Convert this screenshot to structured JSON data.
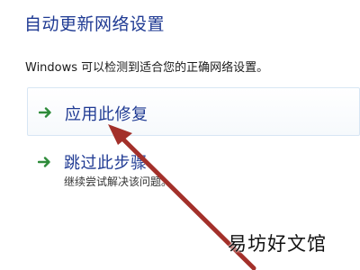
{
  "dialog": {
    "title": "自动更新网络设置",
    "description": "Windows 可以检测到适合您的正确网络设置。"
  },
  "options": {
    "apply": {
      "label": "应用此修复",
      "icon": "green-arrow-icon"
    },
    "skip": {
      "label": "跳过此步骤",
      "sublabel": "继续尝试解决该问题。",
      "icon": "green-arrow-icon"
    }
  },
  "watermark": {
    "text": "易坊好文馆"
  },
  "colors": {
    "title": "#1f3a93",
    "icon": "#2e8b3a",
    "annotation_arrow": "#a3302a"
  }
}
